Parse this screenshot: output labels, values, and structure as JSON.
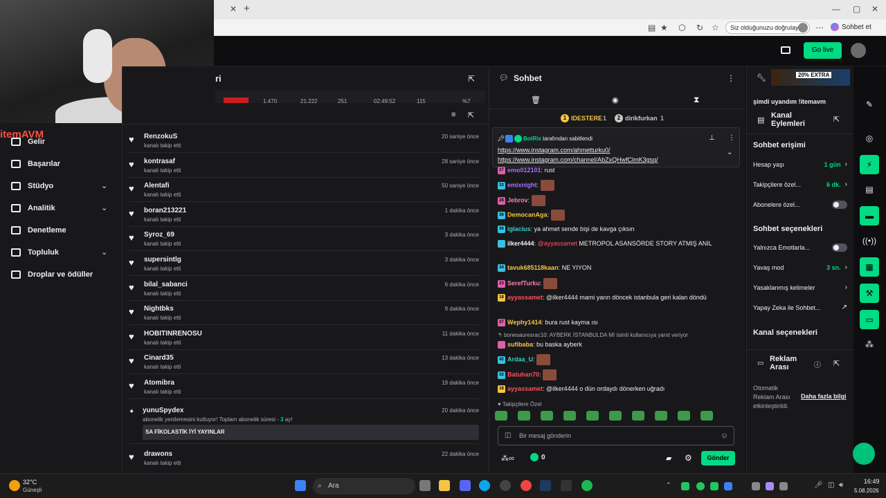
{
  "browser": {
    "verify_label": "Siz olduğunuzu doğrulayın",
    "chat_label": "Sohbet et"
  },
  "topnav": {
    "golive_label": "Go live"
  },
  "logo": {
    "text": "itemAVM"
  },
  "sidebar": {
    "items": [
      {
        "label": "Gelir"
      },
      {
        "label": "Başarılar"
      },
      {
        "label": "Stüdyo"
      },
      {
        "label": "Analitik"
      },
      {
        "label": "Denetleme"
      },
      {
        "label": "Topluluk"
      },
      {
        "label": "Droplar ve ödüller"
      }
    ]
  },
  "stats": {
    "title_fragment": "ri",
    "values": [
      "1.470",
      "21.222",
      "251",
      "02:49:52",
      "115",
      "%7"
    ]
  },
  "activity": [
    {
      "name": "RenzokuS",
      "action": "kanalı takip etti",
      "time": "20 saniye önce"
    },
    {
      "name": "kontrasaf",
      "action": "kanalı takip etti",
      "time": "28 saniye önce"
    },
    {
      "name": "Alentafi",
      "action": "kanalı takip etti",
      "time": "50 saniye önce"
    },
    {
      "name": "boran213221",
      "action": "kanalı takip etti",
      "time": "1 dakika önce"
    },
    {
      "name": "Syroz_69",
      "action": "kanalı takip etti",
      "time": "3 dakika önce"
    },
    {
      "name": "supersintlg",
      "action": "kanalı takip etti",
      "time": "3 dakika önce"
    },
    {
      "name": "bilal_sabanci",
      "action": "kanalı takip etti",
      "time": "6 dakika önce"
    },
    {
      "name": "Nightbks",
      "action": "kanalı takip etti",
      "time": "9 dakika önce"
    },
    {
      "name": "HOBITINRENOSU",
      "action": "kanalı takip etti",
      "time": "11 dakika önce"
    },
    {
      "name": "Cinard35",
      "action": "kanalı takip etti",
      "time": "13 dakika önce"
    },
    {
      "name": "Atomibra",
      "action": "kanalı takip etti",
      "time": "19 dakika önce"
    }
  ],
  "sub_event": {
    "name": "yunuSpydex",
    "text": "abonelik yenilemesini kutluyor! Toplam abonelik süresi -",
    "months": "3",
    "months_unit": "ay!",
    "time": "20 dakika önce",
    "message": "SA FİKOLASTİK İYİ YAYINLAR"
  },
  "activity_last": {
    "name": "drawons",
    "action": "kanalı takip etti",
    "time": "22 dakika önce"
  },
  "chat": {
    "title": "Sohbet",
    "leaderboard": [
      {
        "rank": "1",
        "name": "IDESTERE",
        "count": "1"
      },
      {
        "rank": "2",
        "name": "dirikfurkan",
        "count": "1"
      }
    ],
    "pinned": {
      "by_name": "BotRix",
      "by_text": "tarafından sabitlendi",
      "links": [
        "https://www.instagram.com/ahmetturku0/",
        "https://www.instagram.com/channel/AbZxQHwfClmK3gsq/"
      ]
    },
    "messages": [
      {
        "user": "emo012101",
        "color": "#a970ff",
        "text": ": rust",
        "badge": "27",
        "badge_color": "#e05fa8"
      },
      {
        "user": "emixnight",
        "color": "#a970ff",
        "text": ":",
        "badge": "33",
        "badge_color": "#3bc1e0"
      },
      {
        "user": "Jebrov",
        "color": "#ff7eb6",
        "text": ":",
        "badge": "28",
        "badge_color": "#e05fa8"
      },
      {
        "user": "DemocanAga",
        "color": "#f5c542",
        "text": ":",
        "badge": "36",
        "badge_color": "#3bc1e0"
      },
      {
        "user": "iglacius",
        "color": "#35d0c8",
        "text": ": ya ahmet sende bişi de kavga çıksın",
        "badge": "36",
        "badge_color": "#3bc1e0"
      },
      {
        "user": "ilker4444",
        "color": "#efeff1",
        "mention": "@ayyassamet",
        "text": " METROPOL ASANSÖRDE STORY ATMIŞ ANIL",
        "badge": "",
        "badge_color": "#3bc1e0"
      },
      {
        "user": "tavuk685118kaan",
        "color": "#f5c542",
        "text": ": NE YIYON",
        "badge": "34",
        "badge_color": "#3bc1e0"
      },
      {
        "user": "SerefTurku",
        "color": "#ff7eb6",
        "text": ":",
        "badge": "23",
        "badge_color": "#e05fa8"
      },
      {
        "user": "ayyassamet",
        "color": "#ff4d5e",
        "text": ": @ilker4444 mami yarın döncek istanbula geri kalan döndü",
        "badge": "18",
        "badge_color": "#f5c542"
      },
      {
        "user": "Wephy1414",
        "color": "#f5c542",
        "text": ": bura rust kayma ısı",
        "badge": "27",
        "badge_color": "#e05fa8"
      },
      {
        "user": "sufibaba",
        "color": "#f5c542",
        "text": ": bu baska ayberk",
        "badge": "",
        "badge_color": "#e05fa8"
      },
      {
        "user": "Ardaa_U",
        "color": "#35d0c8",
        "text": ":",
        "badge": "42",
        "badge_color": "#3bc1e0"
      },
      {
        "user": "Batuhan70",
        "color": "#ff4d5e",
        "text": ":",
        "badge": "32",
        "badge_color": "#3bc1e0"
      },
      {
        "user": "ayyassamet",
        "color": "#ff4d5e",
        "text": ": @ilker4444 o dün ordaydı dönerken uğradı",
        "badge": "18",
        "badge_color": "#f5c542"
      }
    ],
    "reply_context": "bonesauresrac10: AYBERK İSTANBULDA MI isimli kullanıcıya yanıt veriyor",
    "followers_only": "Takipçilere Özel",
    "input_placeholder": "Bir mesaj gönderin",
    "points": "0",
    "send_label": "Gönder"
  },
  "settings": {
    "stream_status": "şimdi uyandım !itemavm",
    "channel_actions_title": "Kanal Eylemleri",
    "chat_access_title": "Sohbet erişimi",
    "account_age": {
      "label": "Hesap yaşı",
      "value": "1 gün"
    },
    "followers_only": {
      "label": "Takipçilere özel...",
      "value": "6 dk."
    },
    "subs_only": {
      "label": "Abonelere özel..."
    },
    "chat_options_title": "Sohbet seçenekleri",
    "emotes_only": {
      "label": "Yalnızca Emotlarla..."
    },
    "slow_mode": {
      "label": "Yavaş mod",
      "value": "3 sn."
    },
    "banned_words": {
      "label": "Yasaklanmış kelimeler"
    },
    "ai_chat": {
      "label": "Yapay Zeka ile Sohbet..."
    },
    "channel_options_title": "Kanal seçenekleri",
    "ad_break_title": "Reklam Arası",
    "ad_text": "Otomatik Reklam Arası etkinleştirildi.",
    "ad_link": "Daha fazla bilgi",
    "banner_text": "20% EXTRA"
  },
  "taskbar": {
    "temp": "32°C",
    "weather": "Güneşli",
    "search": "Ara",
    "time": "16:49",
    "date": "5.08.2026"
  }
}
